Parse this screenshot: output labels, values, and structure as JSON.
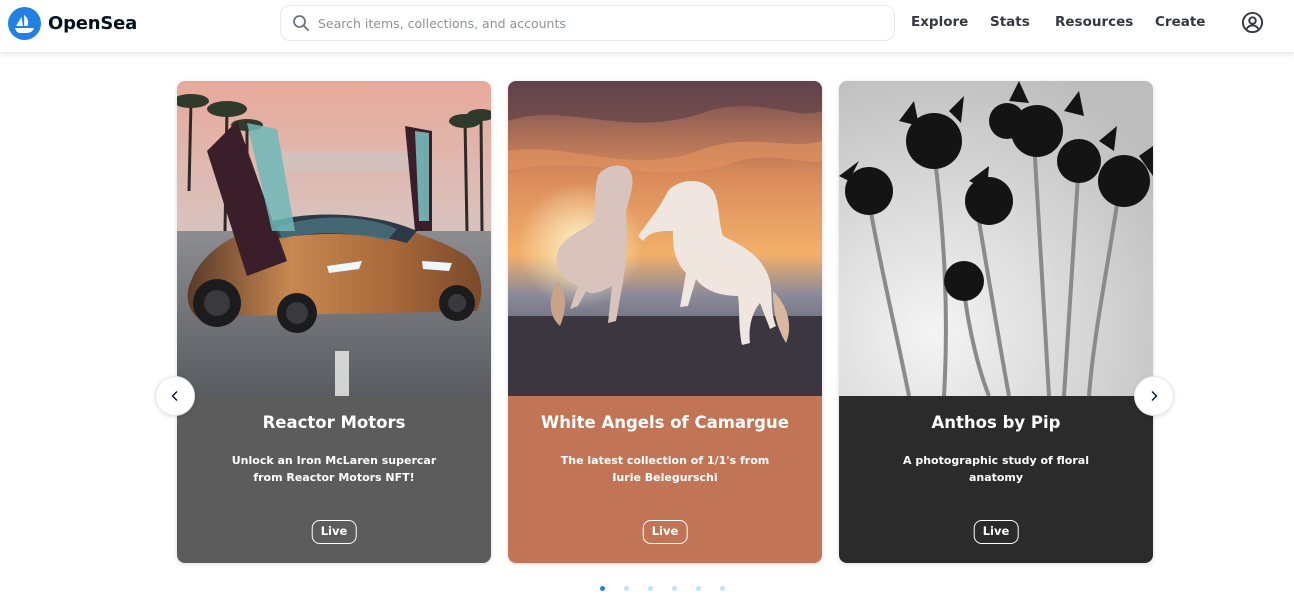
{
  "header": {
    "brand": "OpenSea",
    "search_placeholder": "Search items, collections, and accounts",
    "nav": [
      "Explore",
      "Stats",
      "Resources",
      "Create"
    ]
  },
  "carousel": {
    "cards": [
      {
        "title": "Reactor Motors",
        "description": "Unlock an Iron McLaren supercar from Reactor Motors NFT!",
        "badge": "Live",
        "color": "#5c5c5c"
      },
      {
        "title": "White Angels of Camargue",
        "description": "The latest collection of 1/1's from Iurie Belegurschi",
        "badge": "Live",
        "color": "#c27556"
      },
      {
        "title": "Anthos by Pip",
        "description": "A photographic study of floral anatomy",
        "badge": "Live",
        "color": "#2b2b2b"
      }
    ],
    "page_count": 6,
    "active_page": 1
  },
  "colors": {
    "brand_blue": "#2081e2",
    "text": "#04111d",
    "nav_text": "#353840"
  },
  "icons": [
    "opensea-logo-icon",
    "search-icon",
    "account-icon",
    "chevron-left-icon",
    "chevron-right-icon"
  ]
}
